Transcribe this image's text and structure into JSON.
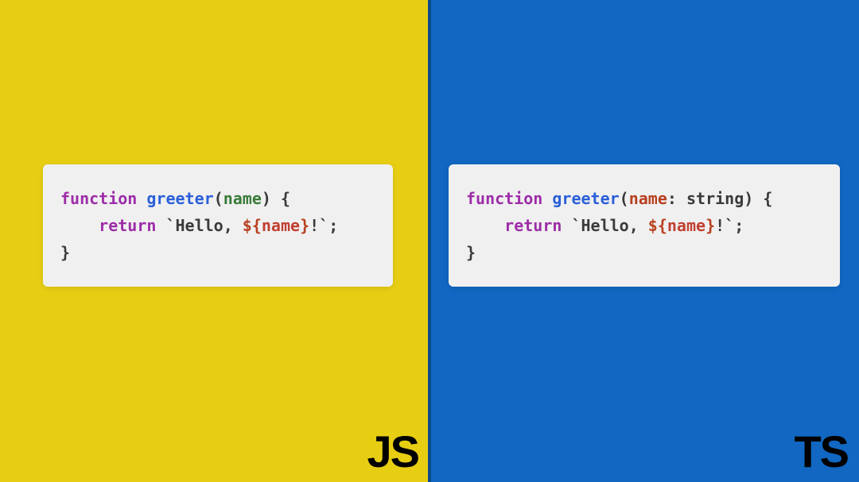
{
  "left": {
    "bg_color": "#e8ce13",
    "badge": "JS",
    "code": {
      "keyword_function": "function",
      "func_name": "greeter",
      "param": "name",
      "keyword_return": "return",
      "string_open": "`Hello, ",
      "interp_dollar": "$",
      "interp_open": "{",
      "interp_var": "name",
      "interp_close": "}",
      "string_close": "!`",
      "semi": ";"
    }
  },
  "right": {
    "bg_color": "#1167c2",
    "badge": "TS",
    "code": {
      "keyword_function": "function",
      "func_name": "greeter",
      "param": "name",
      "colon": ":",
      "type": "string",
      "keyword_return": "return",
      "string_open": "`Hello, ",
      "interp_dollar": "$",
      "interp_open": "{",
      "interp_var": "name",
      "interp_close": "}",
      "string_close": "!`",
      "semi": ";"
    }
  }
}
